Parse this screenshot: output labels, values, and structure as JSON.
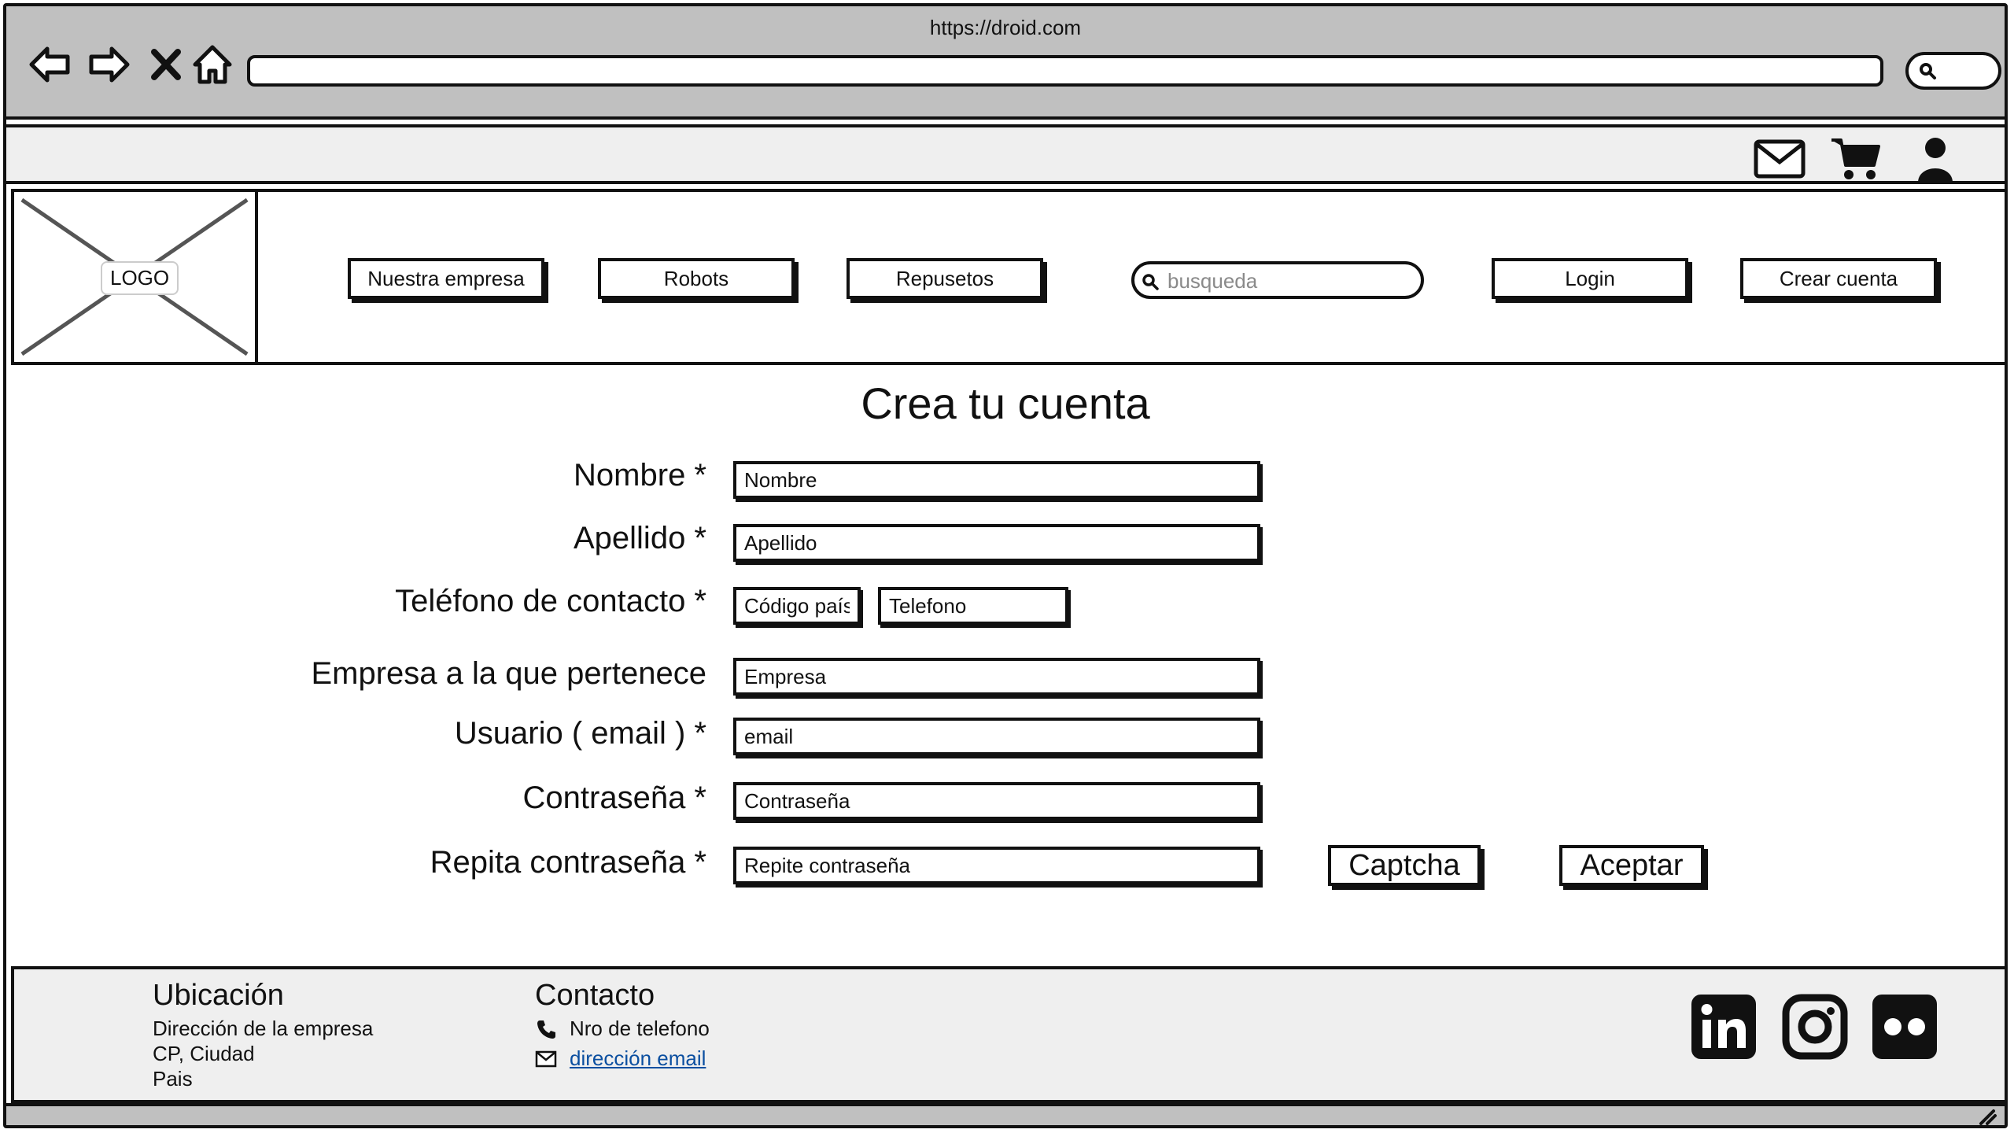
{
  "browser": {
    "url": "https://droid.com",
    "nav_icons": [
      "back-arrow-icon",
      "forward-arrow-icon",
      "close-x-icon",
      "home-icon"
    ],
    "search_icon": "search-icon"
  },
  "utility_bar": {
    "icons": [
      "mail-icon",
      "cart-icon",
      "user-icon"
    ]
  },
  "header": {
    "logo_text": "LOGO",
    "nav": {
      "company": "Nuestra empresa",
      "robots": "Robots",
      "parts": "Repusetos"
    },
    "search_placeholder": "busqueda",
    "login": "Login",
    "create_account": "Crear cuenta"
  },
  "form": {
    "title": "Crea tu cuenta",
    "labels": {
      "name": "Nombre *",
      "surname": "Apellido *",
      "phone": "Teléfono de contacto *",
      "company": "Empresa a la que pertenece",
      "user": "Usuario ( email ) *",
      "password": "Contraseña *",
      "repeat_password": "Repita contraseña *"
    },
    "placeholders": {
      "name": "Nombre",
      "surname": "Apellido",
      "country_code": "Código país",
      "phone": "Telefono",
      "company": "Empresa",
      "user": "email",
      "password": "Contraseña",
      "repeat_password": "Repite contraseña"
    },
    "captcha": "Captcha",
    "accept": "Aceptar"
  },
  "footer": {
    "location": {
      "heading": "Ubicación",
      "lines": [
        "Dirección de la empresa",
        "CP, Ciudad",
        "Pais"
      ]
    },
    "contact": {
      "heading": "Contacto",
      "phone": "Nro de telefono",
      "email": "dirección email"
    },
    "social_icons": [
      "linkedin-icon",
      "instagram-icon",
      "flickr-icon"
    ]
  }
}
